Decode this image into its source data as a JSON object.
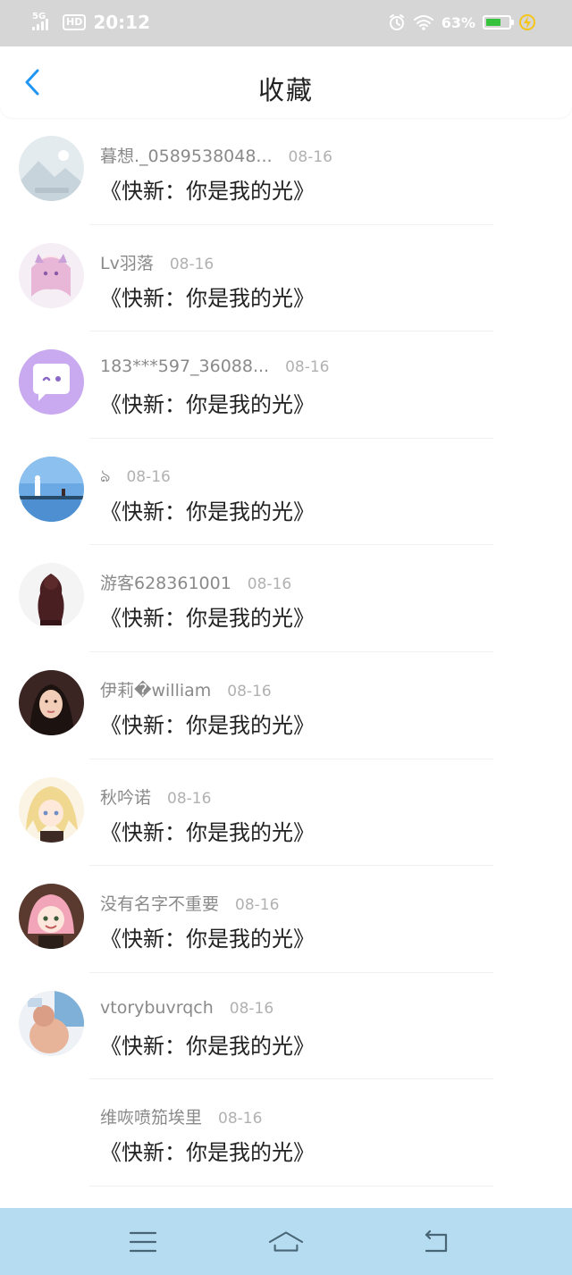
{
  "status_bar": {
    "network": "5G",
    "hd": "HD",
    "time": "20:12",
    "battery_percent": "63%",
    "icons": [
      "signal-icon",
      "alarm-icon",
      "wifi-icon",
      "battery-icon",
      "charging-icon"
    ]
  },
  "header": {
    "title": "收藏",
    "back_icon": "chevron-left-icon",
    "accent": "#2196f3"
  },
  "favorites": [
    {
      "name": "暮想._0589538048...",
      "date": "08-16",
      "content": "《快新：你是我的光》",
      "avatar_icon": "landscape-avatar"
    },
    {
      "name": "Lv羽落",
      "date": "08-16",
      "content": "《快新：你是我的光》",
      "avatar_icon": "anime-girl-avatar"
    },
    {
      "name": "183***597_36088...",
      "date": "08-16",
      "content": "《快新：你是我的光》",
      "avatar_icon": "chat-bubble-avatar"
    },
    {
      "name": "ঌ",
      "date": "08-16",
      "content": "《快新：你是我的光》",
      "avatar_icon": "sky-scene-avatar"
    },
    {
      "name": "游客628361001",
      "date": "08-16",
      "content": "《快新：你是我的光》",
      "avatar_icon": "statue-avatar"
    },
    {
      "name": "伊莉�william",
      "date": "08-16",
      "content": "《快新：你是我的光》",
      "avatar_icon": "portrait-avatar"
    },
    {
      "name": "秋吟诺",
      "date": "08-16",
      "content": "《快新：你是我的光》",
      "avatar_icon": "anime-blonde-avatar"
    },
    {
      "name": "没有名字不重要",
      "date": "08-16",
      "content": "《快新：你是我的光》",
      "avatar_icon": "anime-pink-avatar"
    },
    {
      "name": "vtorybuvrqch",
      "date": "08-16",
      "content": "《快新：你是我的光》",
      "avatar_icon": "photo-avatar"
    },
    {
      "name": "维咴喷笳埃里",
      "date": "08-16",
      "content": "《快新：你是我的光》",
      "avatar_icon": "blank-avatar"
    }
  ],
  "nav_bar": {
    "background": "#b5dcf1",
    "items": [
      "menu-icon",
      "home-icon",
      "back-icon"
    ]
  }
}
